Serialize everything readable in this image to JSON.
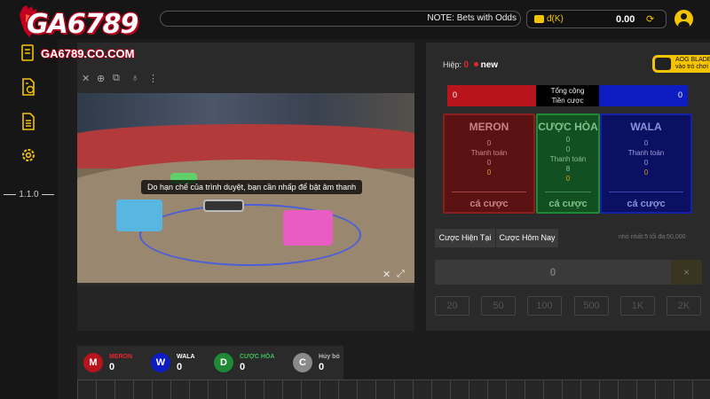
{
  "brand": {
    "logo_text": "GA6789",
    "logo_domain": "GA6789.CO.COM"
  },
  "header": {
    "notice": "NOTE: Bets with Odds",
    "currency": "đ(K)",
    "balance": "0.00",
    "icons": [
      "coin-icon",
      "refresh-icon",
      "user-icon"
    ]
  },
  "sidebar": {
    "icons": [
      "bet-slip-icon",
      "money-doc-icon",
      "report-icon",
      "settings-icon"
    ],
    "version": "1.1.0"
  },
  "video": {
    "toolbar_icons": [
      "close-icon",
      "download-icon",
      "pip-icon",
      "bulb-icon",
      "more-icon"
    ],
    "caption": "Do hạn chế của trình duyệt, bạn cần nhấp để bật âm thanh",
    "controls": [
      "close-icon",
      "fullscreen-icon"
    ]
  },
  "bet_panel": {
    "round_label": "Hiệp:",
    "round_number": "0",
    "round_status": "new",
    "promo_line1": "AOG BLADE",
    "promo_line2": "vào trò chơi",
    "totals": {
      "left": "0",
      "center_line1": "Tổng cộng",
      "center_line2": "Tiền cược",
      "right": "0"
    },
    "sides": [
      {
        "name": "MERON",
        "lines": [
          "0",
          "Thanh toán",
          "0",
          "0"
        ],
        "bet_label": "cá cược"
      },
      {
        "name": "CƯỢC HÒA",
        "lines": [
          "0",
          "0",
          "Thanh toán",
          "8",
          "0"
        ],
        "bet_label": "cá cược"
      },
      {
        "name": "WALA",
        "lines": [
          "0",
          "Thanh toán",
          "0",
          "0"
        ],
        "bet_label": "cá cược"
      }
    ],
    "tabs": [
      "Cược Hiện Tại",
      "Cược Hôm Nay"
    ],
    "limits": "nhỏ nhất:5   tối đa:50,000",
    "amount": "0",
    "clear": "×",
    "chips": [
      "20",
      "50",
      "100",
      "500",
      "1K",
      "2K"
    ]
  },
  "scoreboard": [
    {
      "letter": "M",
      "label": "MERON",
      "count": "0",
      "color": "#b8141b",
      "label_color": "#e9262b"
    },
    {
      "letter": "W",
      "label": "WALA",
      "count": "0",
      "color": "#0d1cc0",
      "label_color": "#ffffff"
    },
    {
      "letter": "D",
      "label": "CƯỢC HÒA",
      "count": "0",
      "color": "#1e8a36",
      "label_color": "#3fbf5a"
    },
    {
      "letter": "C",
      "label": "Hủy bỏ",
      "count": "0",
      "color": "#8a8a8a",
      "label_color": "#bbbbbb"
    }
  ]
}
